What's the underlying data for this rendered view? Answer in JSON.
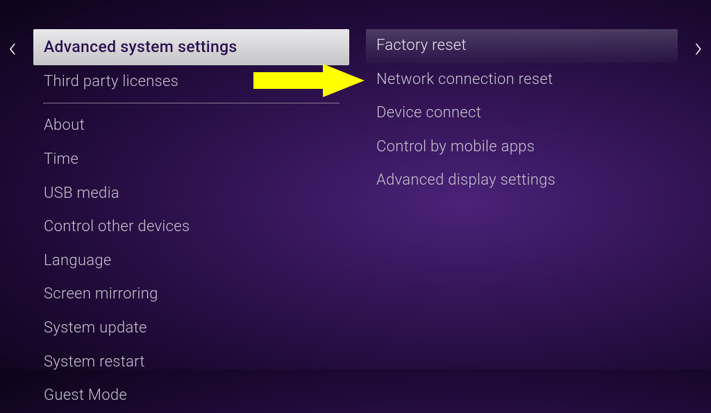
{
  "nav": {
    "left_glyph": "‹",
    "right_glyph": "›"
  },
  "left_menu": {
    "selected": "Advanced system settings",
    "items_top": [
      "Third party licenses"
    ],
    "items_bottom": [
      "About",
      "Time",
      "USB media",
      "Control other devices",
      "Language",
      "Screen mirroring",
      "System update",
      "System restart",
      "Guest Mode"
    ]
  },
  "right_menu": {
    "highlighted": "Factory reset",
    "items": [
      "Network connection reset",
      "Device connect",
      "Control by mobile apps",
      "Advanced display settings"
    ]
  },
  "annotation": {
    "arrow_color": "#ffff00"
  }
}
